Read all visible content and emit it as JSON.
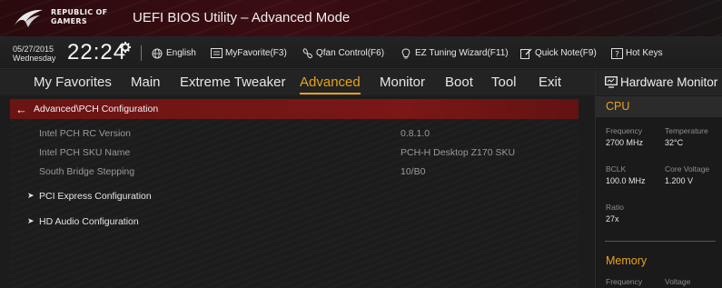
{
  "header": {
    "logo_line1": "REPUBLIC OF",
    "logo_line2": "GAMERS",
    "title": "UEFI BIOS Utility – Advanced Mode"
  },
  "status": {
    "date": "05/27/2015",
    "day": "Wednesday",
    "time": "22:24",
    "items": [
      {
        "label": "English",
        "icon": "globe-icon"
      },
      {
        "label": "MyFavorite(F3)",
        "icon": "favorite-list-icon"
      },
      {
        "label": "Qfan Control(F6)",
        "icon": "fan-icon"
      },
      {
        "label": "EZ Tuning Wizard(F11)",
        "icon": "lightbulb-icon"
      },
      {
        "label": "Quick Note(F9)",
        "icon": "note-icon"
      },
      {
        "label": "Hot Keys",
        "icon": "question-icon"
      }
    ]
  },
  "nav": {
    "tabs": [
      "My Favorites",
      "Main",
      "Extreme Tweaker",
      "Advanced",
      "Monitor",
      "Boot",
      "Tool",
      "Exit"
    ],
    "active": "Advanced"
  },
  "breadcrumb": "Advanced\\PCH Configuration",
  "settings": [
    {
      "label": "Intel PCH RC Version",
      "value": "0.8.1.0"
    },
    {
      "label": "Intel PCH SKU Name",
      "value": "PCH-H Desktop Z170 SKU"
    },
    {
      "label": "South Bridge Stepping",
      "value": "10/B0"
    }
  ],
  "submenus": [
    "PCI Express Configuration",
    "HD Audio Configuration"
  ],
  "hardware_monitor": {
    "title": "Hardware Monitor",
    "cpu": {
      "heading": "CPU",
      "frequency_label": "Frequency",
      "frequency": "2700 MHz",
      "temperature_label": "Temperature",
      "temperature": "32°C",
      "bclk_label": "BCLK",
      "bclk": "100.0 MHz",
      "core_voltage_label": "Core Voltage",
      "core_voltage": "1.200 V",
      "ratio_label": "Ratio",
      "ratio": "27x"
    },
    "memory": {
      "heading": "Memory",
      "frequency_label": "Frequency",
      "voltage_label": "Voltage"
    }
  },
  "colors": {
    "accent": "#e8a31a",
    "highlight": "#7a1717"
  }
}
